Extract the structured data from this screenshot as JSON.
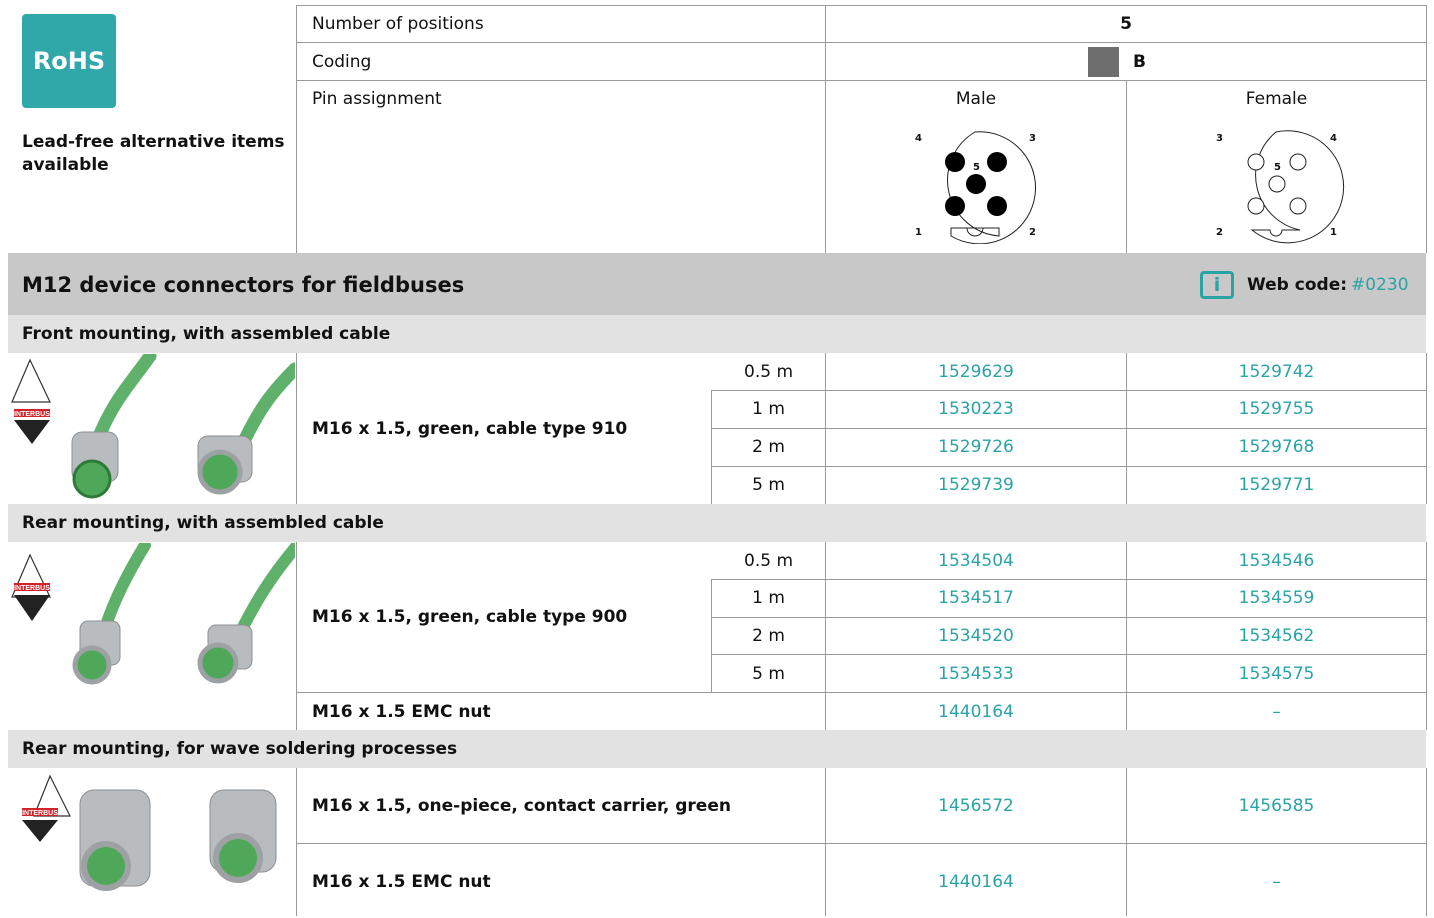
{
  "rohs": {
    "badge": "RoHS",
    "note": "Lead-free alternative items available"
  },
  "spec": {
    "positions_label": "Number of positions",
    "positions_value": "5",
    "coding_label": "Coding",
    "coding_value": "B",
    "pin_label": "Pin assignment",
    "male_label": "Male",
    "female_label": "Female",
    "male_pins": [
      "4",
      "3",
      "5",
      "1",
      "2"
    ],
    "female_pins": [
      "3",
      "4",
      "5",
      "2",
      "1"
    ]
  },
  "section": {
    "title": "M12 device connectors for fieldbuses",
    "web_code_label": "Web code:",
    "web_code_value": "#0230",
    "info_icon": "info-icon"
  },
  "groups": [
    {
      "title": "Front mounting, with assembled cable",
      "logo": "INTERBUS",
      "description": "M16 x 1.5, green, cable type 910",
      "rows": [
        {
          "length": "0.5 m",
          "male": "1529629",
          "female": "1529742"
        },
        {
          "length": "1 m",
          "male": "1530223",
          "female": "1529755"
        },
        {
          "length": "2 m",
          "male": "1529726",
          "female": "1529768"
        },
        {
          "length": "5 m",
          "male": "1529739",
          "female": "1529771"
        }
      ]
    },
    {
      "title": "Rear mounting, with assembled cable",
      "logo": "INTERBUS",
      "description": "M16 x 1.5, green, cable type 900",
      "rows": [
        {
          "length": "0.5 m",
          "male": "1534504",
          "female": "1534546"
        },
        {
          "length": "1 m",
          "male": "1534517",
          "female": "1534559"
        },
        {
          "length": "2 m",
          "male": "1534520",
          "female": "1534562"
        },
        {
          "length": "5 m",
          "male": "1534533",
          "female": "1534575"
        }
      ],
      "extra": {
        "description": "M16 x 1.5 EMC nut",
        "male": "1440164",
        "female": "–"
      }
    },
    {
      "title": "Rear mounting, for wave soldering processes",
      "logo": "INTERBUS",
      "rows": [
        {
          "description": "M16 x 1.5, one-piece, contact carrier, green",
          "male": "1456572",
          "female": "1456585"
        },
        {
          "description": "M16 x 1.5 EMC nut",
          "male": "1440164",
          "female": "–"
        }
      ]
    }
  ],
  "colors": {
    "accent": "#2aa3a6",
    "rohs_bg": "#30a8aa",
    "section_bg": "#c8c8c8",
    "group_bg": "#e2e2e2",
    "cable_green": "#5fb06a",
    "logo_red": "#d2232a"
  }
}
